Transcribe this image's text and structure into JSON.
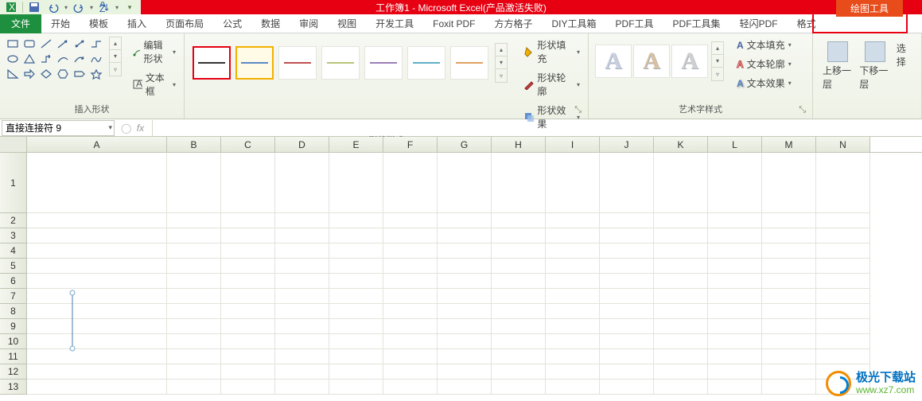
{
  "title": "工作簿1 - Microsoft Excel(产品激活失败)",
  "drawing_tools_tab": "绘图工具",
  "tabs": {
    "file": "文件",
    "list": [
      "开始",
      "模板",
      "插入",
      "页面布局",
      "公式",
      "数据",
      "审阅",
      "视图",
      "开发工具",
      "Foxit PDF",
      "方方格子",
      "DIY工具箱",
      "PDF工具",
      "PDF工具集",
      "轻闪PDF",
      "格式"
    ]
  },
  "ribbon": {
    "insert_shapes": {
      "label": "插入形状",
      "edit_shape": "编辑形状",
      "text_box": "文本框"
    },
    "shape_styles": {
      "label": "形状样式",
      "fill": "形状填充",
      "outline": "形状轮廓",
      "effects": "形状效果",
      "swatches": [
        "#333",
        "#5a8ac6",
        "#c05050",
        "#b8c47a",
        "#9b7fb6",
        "#5fb0c9",
        "#e0a060"
      ]
    },
    "wordart_styles": {
      "label": "艺术字样式",
      "letter": "A",
      "fill": "文本填充",
      "outline": "文本轮廓",
      "effects": "文本效果"
    },
    "arrange": {
      "forward": "上移一层",
      "backward": "下移一层",
      "select": "选择"
    }
  },
  "name_box": "直接连接符 9",
  "fx_label": "fx",
  "columns": [
    "A",
    "B",
    "C",
    "D",
    "E",
    "F",
    "G",
    "H",
    "I",
    "J",
    "K",
    "L",
    "M",
    "N"
  ],
  "rows": [
    "1",
    "2",
    "3",
    "4",
    "5",
    "6",
    "7",
    "8",
    "9",
    "10",
    "11",
    "12",
    "13"
  ],
  "watermark": {
    "name": "极光下载站",
    "url": "www.xz7.com"
  }
}
